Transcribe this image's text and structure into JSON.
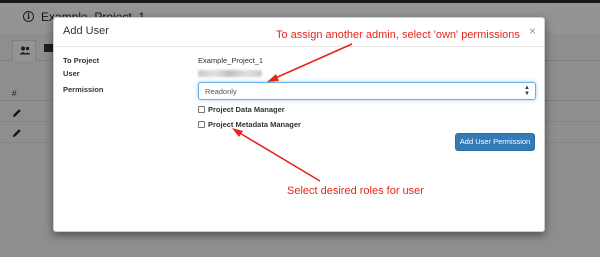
{
  "background": {
    "project_title": "Example_Project_1",
    "table_header": "#"
  },
  "modal": {
    "title": "Add User",
    "close_glyph": "×",
    "to_project_label": "To Project",
    "to_project_value": "Example_Project_1",
    "user_label": "User",
    "permission_label": "Permission",
    "permission_selected": "Readonly",
    "select_caret": "▲\n▼",
    "roles": [
      {
        "label": "Project Data Manager",
        "checked": false
      },
      {
        "label": "Project Metadata Manager",
        "checked": false
      }
    ],
    "add_button_label": "Add User Permission"
  },
  "annotations": {
    "top": "To assign another admin, select 'own' permissions",
    "bottom": "Select desired roles for user",
    "color": "#e8251c"
  },
  "colors": {
    "primary_button": "#337ab7",
    "focus_border": "#66afe9"
  }
}
